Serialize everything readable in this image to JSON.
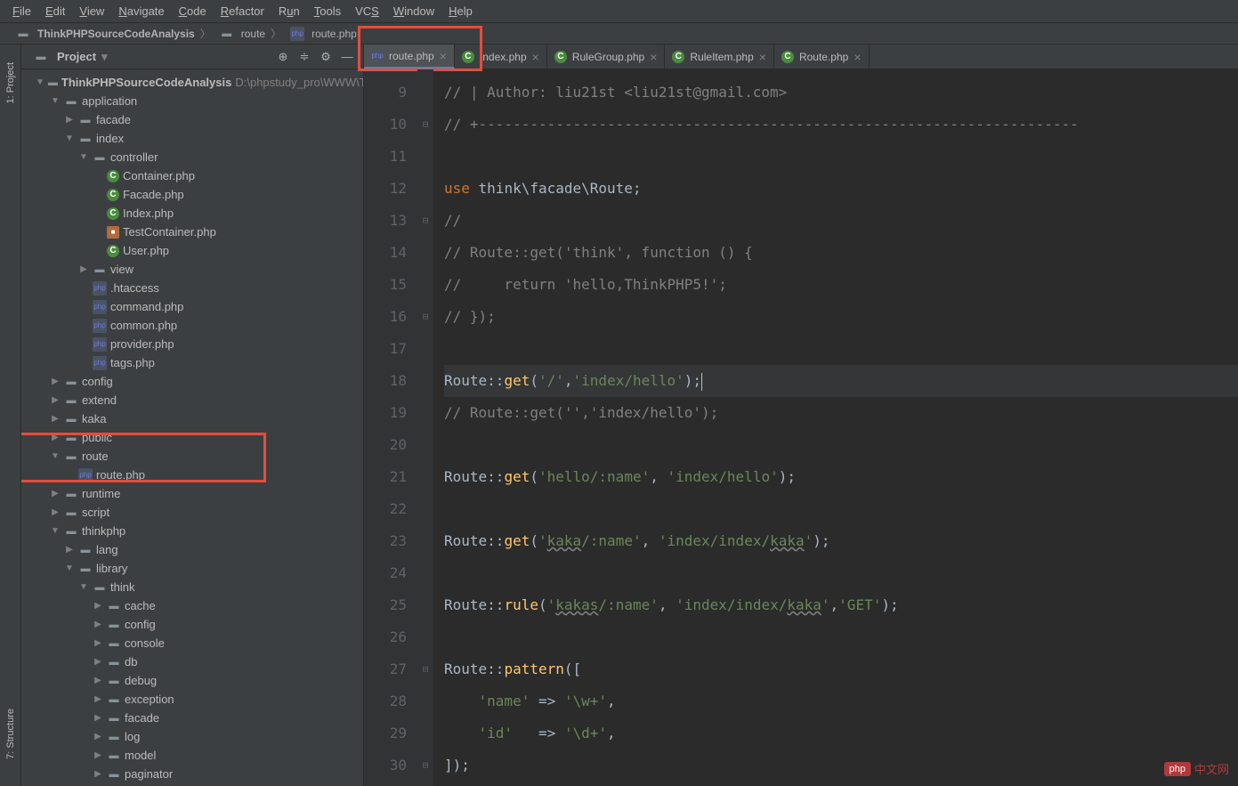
{
  "menu": [
    "File",
    "Edit",
    "View",
    "Navigate",
    "Code",
    "Refactor",
    "Run",
    "Tools",
    "VCS",
    "Window",
    "Help"
  ],
  "breadcrumb": [
    {
      "icon": "folder",
      "label": "ThinkPHPSourceCodeAnalysis"
    },
    {
      "icon": "folder",
      "label": "route"
    },
    {
      "icon": "php",
      "label": "route.php"
    }
  ],
  "gutter_labels": [
    "1: Project",
    "7: Structure"
  ],
  "project_panel": {
    "title": "Project"
  },
  "tree": [
    {
      "depth": 0,
      "arrow": "▼",
      "icon": "folder",
      "label": "ThinkPHPSourceCodeAnalysis",
      "path": "D:\\phpstudy_pro\\WWW\\Thi",
      "bold": true
    },
    {
      "depth": 1,
      "arrow": "▼",
      "icon": "folder",
      "label": "application"
    },
    {
      "depth": 2,
      "arrow": "▶",
      "icon": "folder",
      "label": "facade"
    },
    {
      "depth": 2,
      "arrow": "▼",
      "icon": "folder",
      "label": "index"
    },
    {
      "depth": 3,
      "arrow": "▼",
      "icon": "folder",
      "label": "controller"
    },
    {
      "depth": 4,
      "arrow": "",
      "icon": "class",
      "label": "Container.php"
    },
    {
      "depth": 4,
      "arrow": "",
      "icon": "class",
      "label": "Facade.php"
    },
    {
      "depth": 4,
      "arrow": "",
      "icon": "class",
      "label": "Index.php"
    },
    {
      "depth": 4,
      "arrow": "",
      "icon": "special",
      "label": "TestContainer.php"
    },
    {
      "depth": 4,
      "arrow": "",
      "icon": "class",
      "label": "User.php"
    },
    {
      "depth": 3,
      "arrow": "▶",
      "icon": "folder",
      "label": "view"
    },
    {
      "depth": 3,
      "arrow": "",
      "icon": "php",
      "label": ".htaccess"
    },
    {
      "depth": 3,
      "arrow": "",
      "icon": "php",
      "label": "command.php"
    },
    {
      "depth": 3,
      "arrow": "",
      "icon": "php",
      "label": "common.php"
    },
    {
      "depth": 3,
      "arrow": "",
      "icon": "php",
      "label": "provider.php"
    },
    {
      "depth": 3,
      "arrow": "",
      "icon": "php",
      "label": "tags.php"
    },
    {
      "depth": 1,
      "arrow": "▶",
      "icon": "folder",
      "label": "config"
    },
    {
      "depth": 1,
      "arrow": "▶",
      "icon": "folder",
      "label": "extend"
    },
    {
      "depth": 1,
      "arrow": "▶",
      "icon": "folder",
      "label": "kaka"
    },
    {
      "depth": 1,
      "arrow": "▶",
      "icon": "folder",
      "label": "public"
    },
    {
      "depth": 1,
      "arrow": "▼",
      "icon": "folder",
      "label": "route"
    },
    {
      "depth": 2,
      "arrow": "",
      "icon": "php",
      "label": "route.php"
    },
    {
      "depth": 1,
      "arrow": "▶",
      "icon": "folder",
      "label": "runtime"
    },
    {
      "depth": 1,
      "arrow": "▶",
      "icon": "folder",
      "label": "script"
    },
    {
      "depth": 1,
      "arrow": "▼",
      "icon": "folder",
      "label": "thinkphp"
    },
    {
      "depth": 2,
      "arrow": "▶",
      "icon": "folder",
      "label": "lang"
    },
    {
      "depth": 2,
      "arrow": "▼",
      "icon": "folder",
      "label": "library"
    },
    {
      "depth": 3,
      "arrow": "▼",
      "icon": "folder",
      "label": "think"
    },
    {
      "depth": 4,
      "arrow": "▶",
      "icon": "folder",
      "label": "cache"
    },
    {
      "depth": 4,
      "arrow": "▶",
      "icon": "folder",
      "label": "config"
    },
    {
      "depth": 4,
      "arrow": "▶",
      "icon": "folder",
      "label": "console"
    },
    {
      "depth": 4,
      "arrow": "▶",
      "icon": "folder",
      "label": "db"
    },
    {
      "depth": 4,
      "arrow": "▶",
      "icon": "folder",
      "label": "debug"
    },
    {
      "depth": 4,
      "arrow": "▶",
      "icon": "folder",
      "label": "exception"
    },
    {
      "depth": 4,
      "arrow": "▶",
      "icon": "folder",
      "label": "facade"
    },
    {
      "depth": 4,
      "arrow": "▶",
      "icon": "folder",
      "label": "log"
    },
    {
      "depth": 4,
      "arrow": "▶",
      "icon": "folder",
      "label": "model"
    },
    {
      "depth": 4,
      "arrow": "▶",
      "icon": "folder",
      "label": "paginator"
    }
  ],
  "tabs": [
    {
      "icon": "php",
      "label": "route.php",
      "active": true
    },
    {
      "icon": "class",
      "label": "Index.php"
    },
    {
      "icon": "class",
      "label": "RuleGroup.php"
    },
    {
      "icon": "class",
      "label": "RuleItem.php"
    },
    {
      "icon": "class",
      "label": "Route.php"
    }
  ],
  "line_numbers": [
    9,
    10,
    11,
    12,
    13,
    14,
    15,
    16,
    17,
    18,
    19,
    20,
    21,
    22,
    23,
    24,
    25,
    26,
    27,
    28,
    29,
    30
  ],
  "code": {
    "l9": "// | Author: liu21st <liu21st@gmail.com>",
    "l10": "// +----------------------------------------------------------------------",
    "l12_use": "use",
    "l12_ns": " think\\facade\\Route;",
    "l13": "//",
    "l14": "// Route::get('think', function () {",
    "l15": "//     return 'hello,ThinkPHP5!';",
    "l16": "// });",
    "l18_cls": "Route",
    "l18_op": "::",
    "l18_m": "get",
    "l18_args": "('/','index/hello');",
    "l19": "// Route::get('','index/hello');",
    "l21_args1": "'hello/:name'",
    "l21_args2": "'index/hello'",
    "l23_args1": "'kaka/:name'",
    "l23_args2": "'index/index/kaka'",
    "l25_m": "rule",
    "l25_args1": "'kakas/:name'",
    "l25_args2": "'index/index/kaka'",
    "l25_args3": "'GET'",
    "l27_m": "pattern",
    "l28_k": "'name'",
    "l28_v": "'\\w+'",
    "l29_k": "'id'",
    "l29_v": "'\\d+'"
  },
  "watermark": "中文网"
}
